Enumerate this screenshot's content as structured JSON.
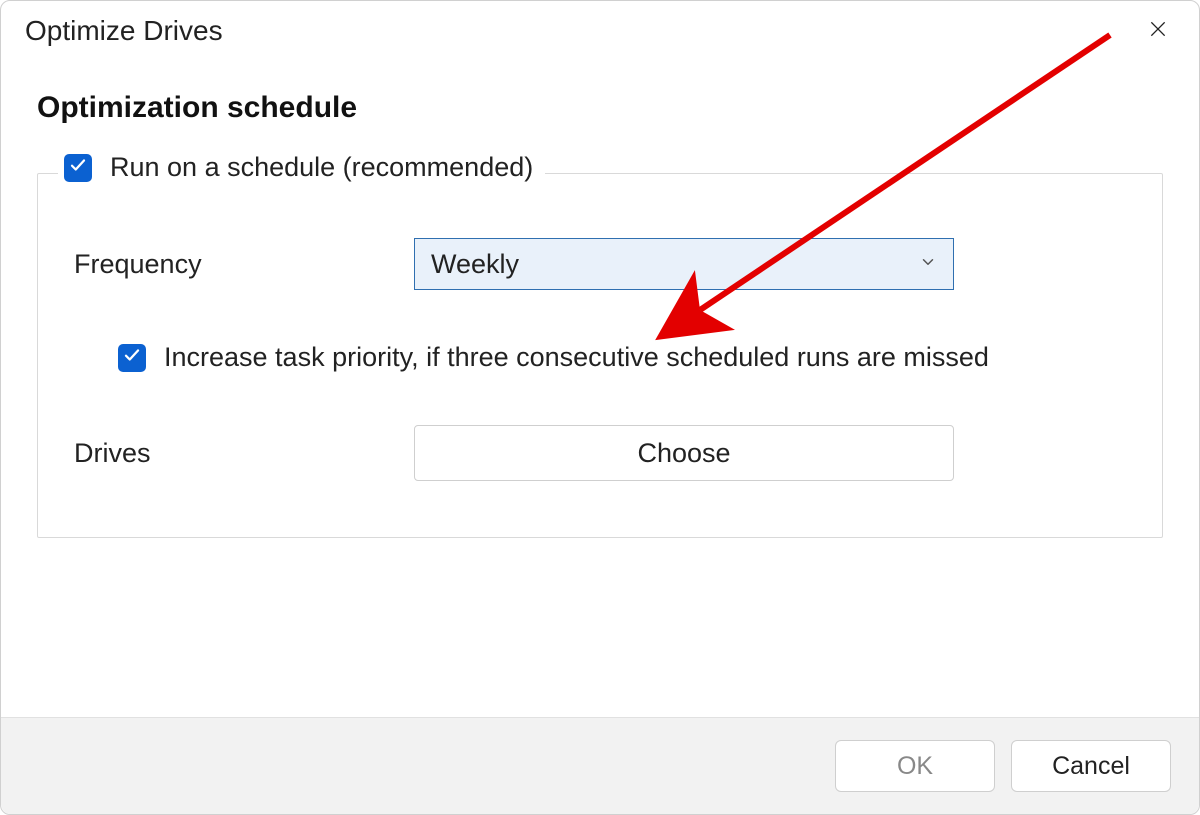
{
  "window": {
    "title": "Optimize Drives"
  },
  "section": {
    "heading": "Optimization schedule"
  },
  "schedule": {
    "run_on_schedule": {
      "checked": true,
      "label": "Run on a schedule (recommended)"
    },
    "frequency": {
      "label": "Frequency",
      "value": "Weekly"
    },
    "increase_priority": {
      "checked": true,
      "label": "Increase task priority, if three consecutive scheduled runs are missed"
    },
    "drives": {
      "label": "Drives",
      "button": "Choose"
    }
  },
  "footer": {
    "ok": "OK",
    "cancel": "Cancel"
  },
  "annotation": {
    "arrow_color": "#e30000"
  }
}
